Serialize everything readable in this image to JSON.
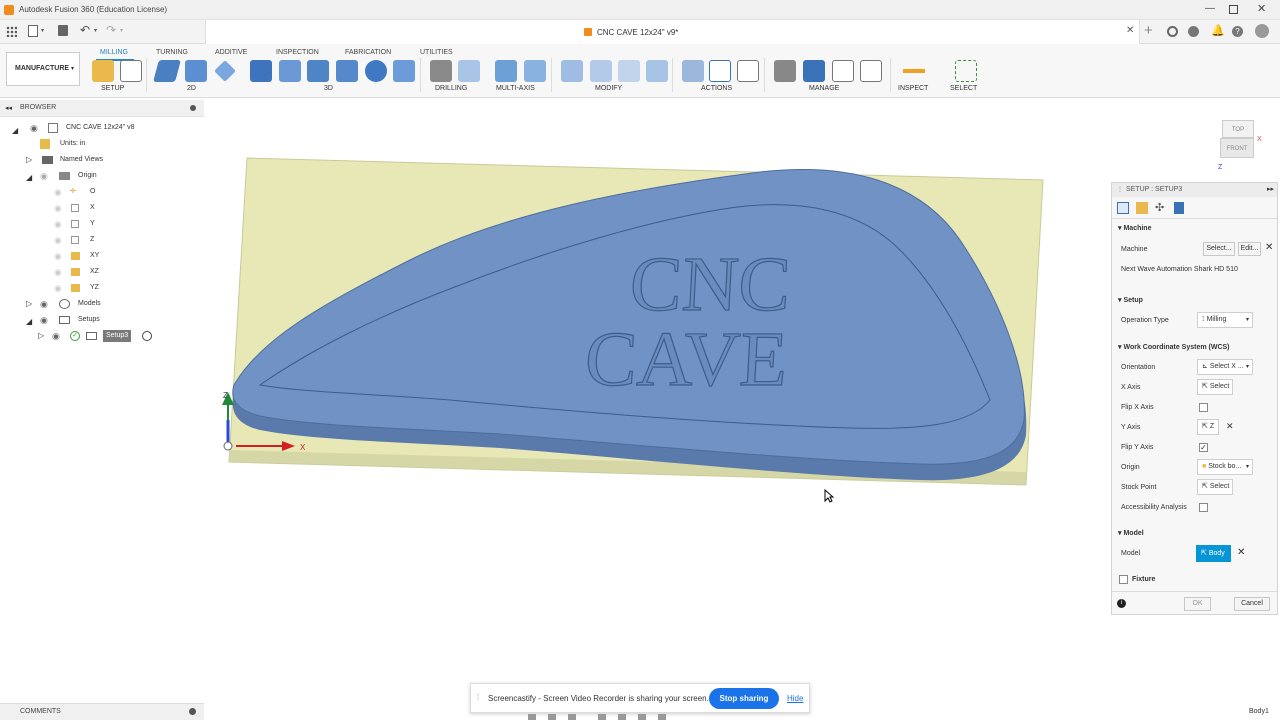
{
  "window": {
    "title": "Autodesk Fusion 360 (Education License)"
  },
  "document_tab": {
    "title": "CNC CAVE 12x24\" v9*"
  },
  "workspace": {
    "label": "MANUFACTURE"
  },
  "ribbon": {
    "tabs": [
      "MILLING",
      "TURNING",
      "ADDITIVE",
      "INSPECTION",
      "FABRICATION",
      "UTILITIES"
    ],
    "groups": [
      "SETUP",
      "2D",
      "3D",
      "DRILLING",
      "MULTI-AXIS",
      "MODIFY",
      "ACTIONS",
      "MANAGE",
      "INSPECT",
      "SELECT"
    ]
  },
  "browser": {
    "header": "BROWSER",
    "root": "CNC CAVE 12x24\" v8",
    "units": "Units: in",
    "named_views": "Named Views",
    "origin": "Origin",
    "origin_items": [
      "O",
      "X",
      "Y",
      "Z",
      "XY",
      "XZ",
      "YZ"
    ],
    "models": "Models",
    "setups": "Setups",
    "setup_item": "Setup3"
  },
  "model": {
    "line1": "CNC",
    "line2": "CAVE"
  },
  "axes": {
    "x": "X",
    "z": "Z"
  },
  "viewcube": {
    "top": "TOP",
    "front": "FRONT",
    "x": "X",
    "z": "Z"
  },
  "setup_panel": {
    "title": "SETUP : SETUP3",
    "machine": {
      "section": "Machine",
      "label": "Machine",
      "select": "Select...",
      "edit": "Edit...",
      "name": "Next Wave Automation Shark HD 510"
    },
    "setup": {
      "section": "Setup",
      "op_type_label": "Operation Type",
      "op_type_value": "Milling"
    },
    "wcs": {
      "section": "Work Coordinate System (WCS)",
      "orientation_label": "Orientation",
      "orientation_value": "Select X ...",
      "x_axis_label": "X Axis",
      "x_axis_value": "Select",
      "flip_x_label": "Flip X Axis",
      "flip_x": false,
      "y_axis_label": "Y Axis",
      "y_axis_value": "Z",
      "flip_y_label": "Flip Y Axis",
      "flip_y": true,
      "origin_label": "Origin",
      "origin_value": "Stock bo...",
      "stock_point_label": "Stock Point",
      "stock_point_value": "Select",
      "accessibility_label": "Accessibility Analysis",
      "accessibility": false
    },
    "model": {
      "section": "Model",
      "label": "Model",
      "value": "Body"
    },
    "fixture": {
      "label": "Fixture",
      "checked": false
    },
    "ok": "OK",
    "cancel": "Cancel"
  },
  "sharing_bar": {
    "text": "Screencastify - Screen Video Recorder is sharing your screen.",
    "stop": "Stop sharing",
    "hide": "Hide"
  },
  "comments": {
    "label": "COMMENTS"
  },
  "status": {
    "selection": "Body1"
  },
  "colors": {
    "accent": "#0696d7",
    "stock": "#e7e8b5",
    "body": "#6f8fbf",
    "ribbon_active": "#2a82c9"
  }
}
